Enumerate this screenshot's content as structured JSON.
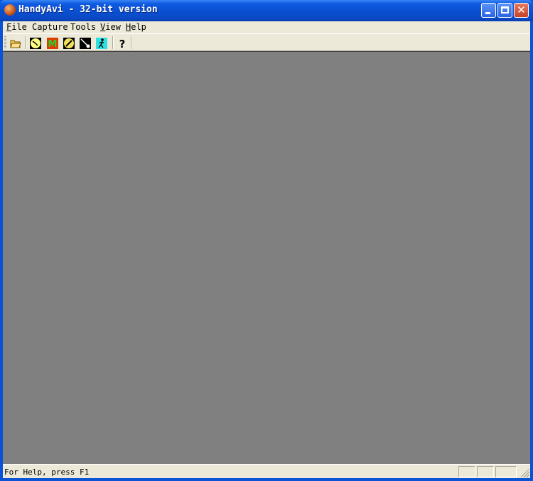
{
  "window": {
    "title": "HandyAvi - 32-bit version"
  },
  "menubar": {
    "items": [
      {
        "label": "File",
        "accel": "F",
        "rest": "ile"
      },
      {
        "label": "Capture",
        "accel": "",
        "rest": "Capture"
      },
      {
        "label": "Tools",
        "accel": "",
        "rest": "Tools"
      },
      {
        "label": "View",
        "accel": "V",
        "rest": "iew"
      },
      {
        "label": "Help",
        "accel": "H",
        "rest": "elp"
      }
    ]
  },
  "toolbar": {
    "tools": [
      {
        "name": "open-folder-icon"
      },
      {
        "name": "timer-clock-icon"
      },
      {
        "name": "motion-m-icon"
      },
      {
        "name": "pencil-edit-icon"
      },
      {
        "name": "draw-line-icon"
      },
      {
        "name": "run-figure-icon"
      },
      {
        "name": "help-question-icon"
      }
    ]
  },
  "statusbar": {
    "text": "For Help, press F1"
  },
  "colors": {
    "titlebar": "#0a4fd2",
    "chrome": "#ece9d8",
    "workspace": "#808080"
  }
}
